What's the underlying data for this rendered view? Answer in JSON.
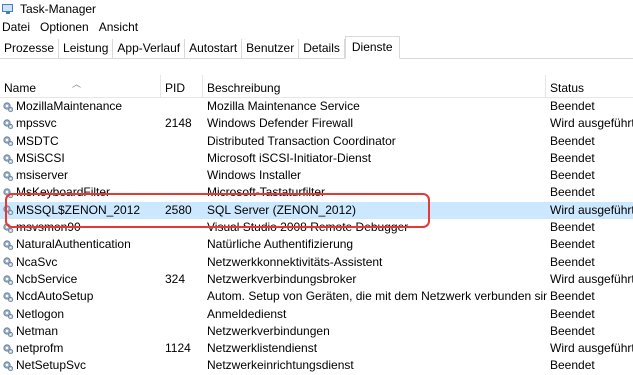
{
  "window": {
    "title": "Task-Manager"
  },
  "menu": {
    "items": [
      "Datei",
      "Optionen",
      "Ansicht"
    ]
  },
  "tabs": [
    {
      "label": "Prozesse",
      "active": false
    },
    {
      "label": "Leistung",
      "active": false
    },
    {
      "label": "App-Verlauf",
      "active": false
    },
    {
      "label": "Autostart",
      "active": false
    },
    {
      "label": "Benutzer",
      "active": false
    },
    {
      "label": "Details",
      "active": false
    },
    {
      "label": "Dienste",
      "active": true
    }
  ],
  "table": {
    "columns": {
      "name": "Name",
      "pid": "PID",
      "description": "Beschreibung",
      "status": "Status"
    },
    "rows": [
      {
        "name": "MozillaMaintenance",
        "pid": "",
        "description": "Mozilla Maintenance Service",
        "status": "Beendet"
      },
      {
        "name": "mpssvc",
        "pid": "2148",
        "description": "Windows Defender Firewall",
        "status": "Wird ausgeführt"
      },
      {
        "name": "MSDTC",
        "pid": "",
        "description": "Distributed Transaction Coordinator",
        "status": "Beendet"
      },
      {
        "name": "MSiSCSI",
        "pid": "",
        "description": "Microsoft iSCSI-Initiator-Dienst",
        "status": "Beendet"
      },
      {
        "name": "msiserver",
        "pid": "",
        "description": "Windows Installer",
        "status": "Beendet"
      },
      {
        "name": "MsKeyboardFilter",
        "pid": "",
        "description": "Microsoft-Tastaturfilter",
        "status": "Beendet"
      },
      {
        "name": "MSSQL$ZENON_2012",
        "pid": "2580",
        "description": "SQL Server (ZENON_2012)",
        "status": "Wird ausgeführt",
        "selected": true
      },
      {
        "name": "msvsmon90",
        "pid": "",
        "description": "Visual Studio 2008 Remote Debugger",
        "status": "Beendet"
      },
      {
        "name": "NaturalAuthentication",
        "pid": "",
        "description": "Natürliche Authentifizierung",
        "status": "Beendet"
      },
      {
        "name": "NcaSvc",
        "pid": "",
        "description": "Netzwerkkonnektivitäts-Assistent",
        "status": "Beendet"
      },
      {
        "name": "NcbService",
        "pid": "324",
        "description": "Netzwerkverbindungsbroker",
        "status": "Wird ausgeführt"
      },
      {
        "name": "NcdAutoSetup",
        "pid": "",
        "description": "Autom. Setup von Geräten, die mit dem Netzwerk verbunden sind",
        "status": "Beendet"
      },
      {
        "name": "Netlogon",
        "pid": "",
        "description": "Anmeldedienst",
        "status": "Beendet"
      },
      {
        "name": "Netman",
        "pid": "",
        "description": "Netzwerkverbindungen",
        "status": "Beendet"
      },
      {
        "name": "netprofm",
        "pid": "1124",
        "description": "Netzwerklistendienst",
        "status": "Wird ausgeführt"
      },
      {
        "name": "NetSetupSvc",
        "pid": "",
        "description": "Netzwerkeinrichtungsdienst",
        "status": "Beendet"
      }
    ]
  },
  "icons": {
    "app": "task-manager-icon",
    "service": "service-gear-icon",
    "sort": "sort-up-caret-icon"
  },
  "colors": {
    "selection": "#cce8ff",
    "highlight": "#e53935"
  }
}
